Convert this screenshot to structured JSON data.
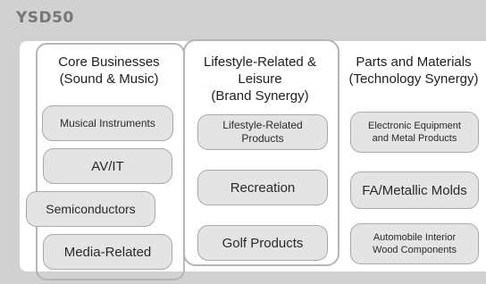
{
  "brand": "YSD50",
  "columns": {
    "core": {
      "title": "Core Businesses\n(Sound & Music)",
      "items": [
        "Musical Instruments",
        "AV/IT",
        "Semiconductors",
        "Media-Related"
      ]
    },
    "lifestyle": {
      "title": "Lifestyle-Related &\nLeisure\n(Brand Synergy)",
      "items": [
        "Lifestyle-Related\nProducts",
        "Recreation",
        "Golf Products"
      ]
    },
    "parts": {
      "title": "Parts and Materials\n(Technology Synergy)",
      "items": [
        "Electronic Equipment\nand Metal Products",
        "FA/Metallic Molds",
        "Automobile Interior\nWood Components"
      ]
    }
  },
  "colors": {
    "background": "#d1d1d1",
    "panel": "#ffffff",
    "pill_fill": "#e4e4e4",
    "pill_border": "#a9a9a9",
    "group_border": "#b5b5b5",
    "brand_text": "#767676"
  }
}
